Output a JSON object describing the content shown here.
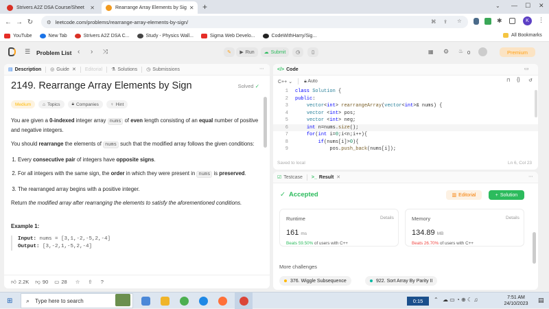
{
  "browser": {
    "tabs": [
      {
        "title": "Strivers A2Z DSA Course/Sheet",
        "icon_color": "#d93025"
      },
      {
        "title": "Rearrange Array Elements by Sig",
        "icon_color": "#f29a1f"
      }
    ],
    "new_tab_symbol": "+",
    "url": "leetcode.com/problems/rearrange-array-elements-by-sign/",
    "bookmarks": [
      {
        "label": "YouTube",
        "icon_color": "#e52d27"
      },
      {
        "label": "New Tab",
        "icon_color": "#1a73e8"
      },
      {
        "label": "Strivers A2Z DSA C...",
        "icon_color": "#d93025"
      },
      {
        "label": "Study - Physics Wall...",
        "icon_color": "#444444"
      },
      {
        "label": "Sigma Web Develo...",
        "icon_color": "#e52d27"
      },
      {
        "label": "CodeWithHarry/Sig...",
        "icon_color": "#222222"
      }
    ],
    "all_bookmarks": "All Bookmarks",
    "profile_letter": "K"
  },
  "lc_nav": {
    "problem_list": "Problem List",
    "run": "Run",
    "submit": "Submit",
    "streak": "0",
    "premium": "Premium"
  },
  "left_tabs": {
    "description": "Description",
    "guide": "Guide",
    "editorial": "Editorial",
    "solutions": "Solutions",
    "submissions": "Submissions"
  },
  "problem": {
    "title": "2149. Rearrange Array Elements by Sign",
    "status": "Solved",
    "difficulty": "Medium",
    "topics": "Topics",
    "companies": "Companies",
    "hint": "Hint",
    "p1_a": "You are given a ",
    "p1_b": "0-indexed",
    "p1_c": " integer array ",
    "p1_code": "nums",
    "p1_d": " of ",
    "p1_e": "even",
    "p1_f": " length consisting of an ",
    "p1_g": "equal",
    "p1_h": " number of positive and negative integers.",
    "p2_a": "You should ",
    "p2_b": "rearrange",
    "p2_c": " the elements of ",
    "p2_code": "nums",
    "p2_d": " such that the modified array follows the given conditions:",
    "c1_a": "Every ",
    "c1_b": "consecutive pair",
    "c1_c": " of integers have ",
    "c1_d": "opposite signs",
    "c1_e": ".",
    "c2_a": "For all integers with the same sign, the ",
    "c2_b": "order",
    "c2_c": " in which they were present in ",
    "c2_code": "nums",
    "c2_d": " is ",
    "c2_e": "preserved",
    "c2_f": ".",
    "c3": "The rearranged array begins with a positive integer.",
    "ret_a": "Return ",
    "ret_b": "the modified array after rearranging the elements to satisfy the aforementioned conditions.",
    "example_title": "Example 1:",
    "input_label": "Input:",
    "input_value": " nums = [3,1,-2,-5,2,-4]",
    "output_label": "Output:",
    "output_value": " [3,-2,1,-5,2,-4]"
  },
  "footer": {
    "likes": "2.2K",
    "dislikes": "90",
    "comments": "28"
  },
  "code_panel": {
    "title": "Code",
    "language": "C++",
    "mode": "Auto",
    "saved": "Saved to local",
    "cursor": "Ln 6, Col 23",
    "lines": [
      {
        "n": "1",
        "t": "class Solution {"
      },
      {
        "n": "2",
        "t": "public:"
      },
      {
        "n": "3",
        "t": "    vector<int> rearrangeArray(vector<int>& nums) {"
      },
      {
        "n": "4",
        "t": "    vector <int> pos;"
      },
      {
        "n": "5",
        "t": "    vector <int> neg;"
      },
      {
        "n": "6",
        "t": "    int n=nums.size();"
      },
      {
        "n": "7",
        "t": "    for(int i=0;i<n;i++){"
      },
      {
        "n": "8",
        "t": "        if(nums[i]>0){"
      },
      {
        "n": "9",
        "t": "            pos.push_back(nums[i]);"
      }
    ]
  },
  "result_panel": {
    "testcase": "Testcase",
    "result": "Result",
    "accepted": "Accepted",
    "editorial": "Editorial",
    "solution": "Solution",
    "runtime_label": "Runtime",
    "runtime_value": "161",
    "runtime_unit": "ms",
    "runtime_beats_pct": "Beats 59.50%",
    "runtime_beats_text": " of users with C++",
    "details": "Details",
    "memory_label": "Memory",
    "memory_value": "134.89",
    "memory_unit": "MB",
    "memory_beats_pct": "Beats 26.70%",
    "memory_beats_text": " of users with C++",
    "more": "More challenges",
    "challenges": [
      {
        "label": "376. Wiggle Subsequence",
        "color": "#ffb800"
      },
      {
        "label": "922. Sort Array By Parity II",
        "color": "#00b8a3"
      }
    ]
  },
  "taskbar": {
    "search": "Type here to search",
    "timer": "0:15",
    "time": "7:51 AM",
    "date": "24/10/2023"
  },
  "colors": {
    "accent_green": "#2cbb5d",
    "medium": "#ffb800",
    "editorial_orange": "#f57c00",
    "red_beats": "#ef4743",
    "premium": "#ffa116"
  }
}
